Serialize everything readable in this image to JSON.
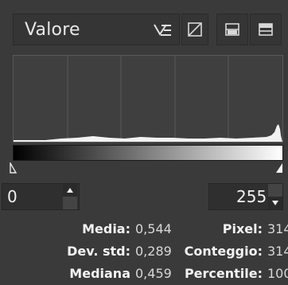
{
  "channel": {
    "selected": "Valore"
  },
  "toolbar": {
    "icons": [
      "channel-menu-icon",
      "linear-icon",
      "histogram-mode-icon",
      "reset-icon"
    ]
  },
  "histogram": {
    "grid_lines": 5,
    "bar_color": "#f2f2f2",
    "background": "#3f3f3f"
  },
  "range": {
    "low": "0",
    "high": "255"
  },
  "stats": {
    "media_label": "Media:",
    "media_value": "0,544",
    "devstd_label": "Dev. std:",
    "devstd_value": "0,289",
    "mediana_label": "Mediana",
    "mediana_value": "0,459",
    "pixel_label": "Pixel:",
    "pixel_value": "314",
    "conteggio_label": "Conteggio:",
    "conteggio_value": "314",
    "percentile_label": "Percentile:",
    "percentile_value": "100"
  }
}
